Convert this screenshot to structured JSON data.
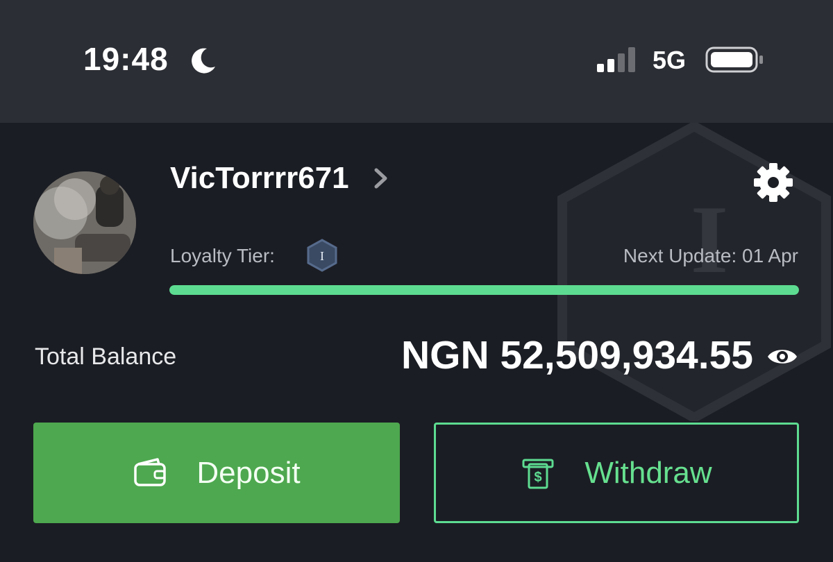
{
  "status_bar": {
    "time": "19:48",
    "moon_icon": "moon-icon",
    "signal_icon": "cellular-signal-icon",
    "network": "5G",
    "battery_icon": "battery-icon"
  },
  "profile": {
    "username": "VicTorrrr671",
    "loyalty_label": "Loyalty Tier:",
    "tier_badge_text": "I",
    "next_update": "Next Update: 01 Apr",
    "progress_fraction": 1.0
  },
  "balance": {
    "label": "Total Balance",
    "amount": "NGN 52,509,934.55"
  },
  "buttons": {
    "deposit_label": "Deposit",
    "withdraw_label": "Withdraw"
  },
  "colors": {
    "accent_green": "#5ddc91",
    "deposit_bg": "#4ea84f",
    "background": "#1b1d24",
    "status_bg": "#2c2e35"
  }
}
